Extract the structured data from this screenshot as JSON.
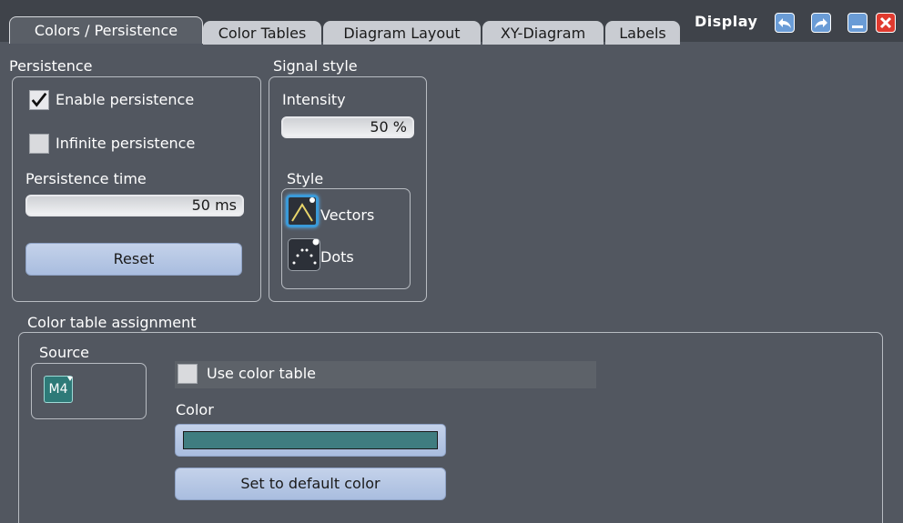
{
  "tabs": [
    {
      "label": "Colors / Persistence",
      "active": true
    },
    {
      "label": "Color Tables",
      "active": false
    },
    {
      "label": "Diagram Layout",
      "active": false
    },
    {
      "label": "XY-Diagram",
      "active": false
    },
    {
      "label": "Labels",
      "active": false
    }
  ],
  "dialog": {
    "title": "Display"
  },
  "persistence": {
    "group_label": "Persistence",
    "enable_label": "Enable persistence",
    "enable_checked": true,
    "infinite_label": "Infinite persistence",
    "infinite_checked": false,
    "time_label": "Persistence time",
    "time_value": "50 ms",
    "reset_label": "Reset"
  },
  "signal_style": {
    "group_label": "Signal style",
    "intensity_label": "Intensity",
    "intensity_value": "50 %",
    "style_label": "Style",
    "options": [
      {
        "label": "Vectors",
        "icon": "vectors-icon",
        "selected": true
      },
      {
        "label": "Dots",
        "icon": "dots-icon",
        "selected": false
      }
    ]
  },
  "color_table_assignment": {
    "group_label": "Color table assignment",
    "source_label": "Source",
    "source_value": "M4",
    "use_color_table_label": "Use color table",
    "use_color_table_checked": false,
    "color_label": "Color",
    "color_value": "#3f7d80",
    "default_button_label": "Set to default color"
  },
  "colors": {
    "background": "#525760",
    "accent_blue": "#a9bddf",
    "source_teal": "#2e7a78",
    "close_red": "#e03a2f"
  }
}
